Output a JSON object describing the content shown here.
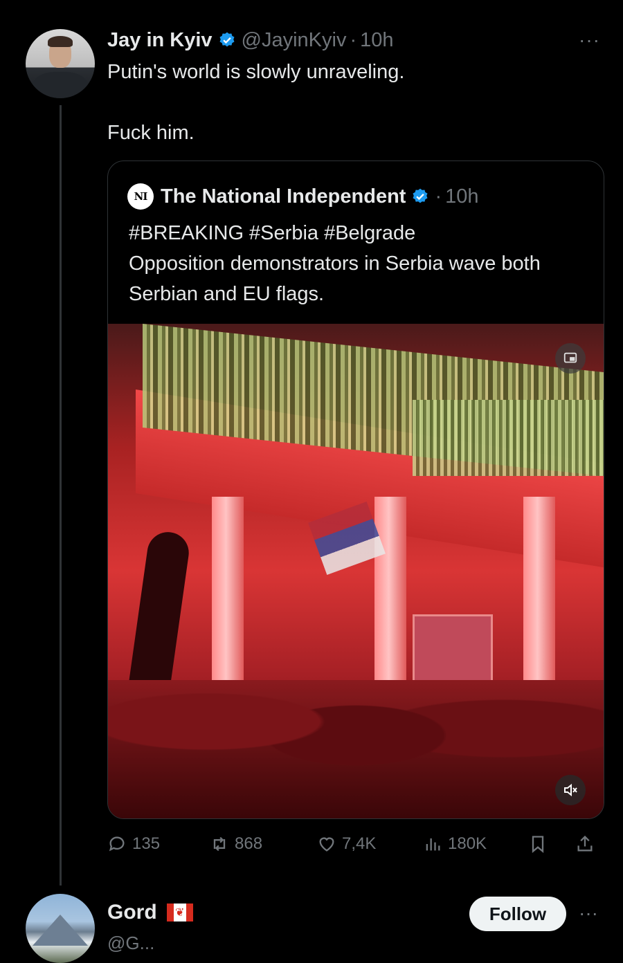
{
  "tweet": {
    "author_name": "Jay in Kyiv",
    "author_handle": "@JayinKyiv",
    "separator": "·",
    "time": "10h",
    "more": "···",
    "text": "Putin's world is slowly unraveling.\n\nFuck him."
  },
  "quote": {
    "logo_text": "NI",
    "author_name": "The National Independent",
    "separator": "·",
    "time": "10h",
    "text": "#BREAKING #Serbia #Belgrade\nOpposition demonstrators in Serbia wave both Serbian and EU flags."
  },
  "actions": {
    "replies": "135",
    "reposts": "868",
    "likes": "7,4K",
    "views": "180K"
  },
  "reply": {
    "author_name": "Gord",
    "follow_label": "Follow",
    "handle": "@G...",
    "more": "···"
  },
  "colors": {
    "background": "#000000",
    "text": "#e7e9ea",
    "muted": "#71767b",
    "verified": "#1d9bf0",
    "border": "#2f3336"
  }
}
